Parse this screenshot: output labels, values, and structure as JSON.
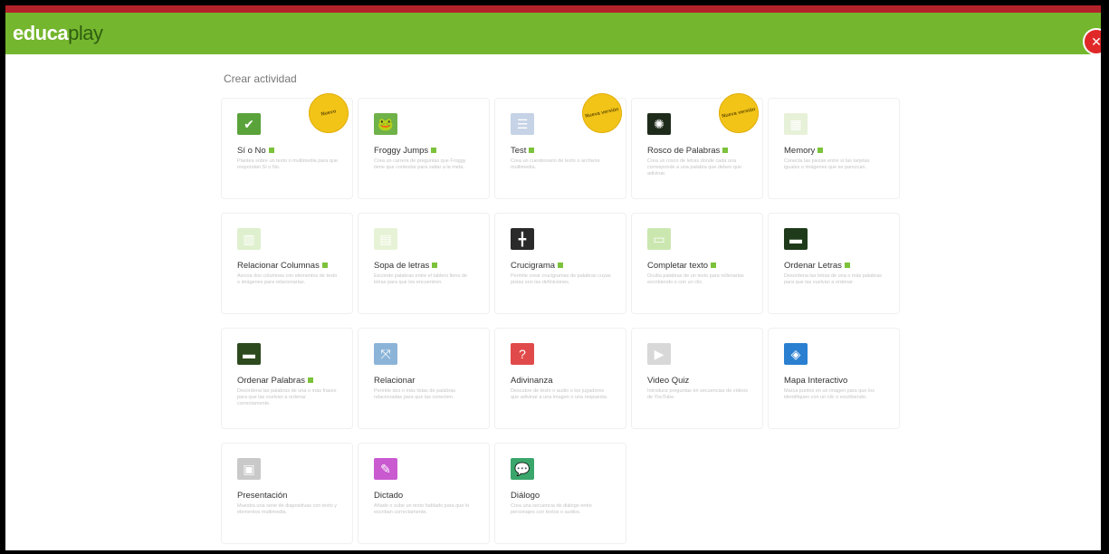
{
  "app": {
    "logo_text": "educa",
    "logo_text_light": "play"
  },
  "colors": {
    "brand_green": "#74b62e",
    "top_strip": "#b3222a",
    "badge": "#f2c418",
    "premium_dot": "#7cc23a"
  },
  "page": {
    "heading": "Crear actividad"
  },
  "activities": [
    {
      "name": "Sí o No",
      "desc": "Plantea sobre un texto o multimedia para que respondan Sí o No.",
      "badge": "Nuevo",
      "icon": "check-cross-icon",
      "premium": true
    },
    {
      "name": "Froggy Jumps",
      "desc": "Crea un carrera de preguntas que Froggy tiene que contestar para saltar a la meta.",
      "badge": "",
      "icon": "frog-icon",
      "premium": true
    },
    {
      "name": "Test",
      "desc": "Crea un cuestionario de texto o archivos multimedia.",
      "badge": "Nueva versión",
      "icon": "test-list-icon",
      "premium": true
    },
    {
      "name": "Rosco de Palabras",
      "desc": "Crea un rosco de letras donde cada una corresponde a una palabra que deben que adivinar.",
      "badge": "Nueva versión",
      "icon": "letter-wheel-icon",
      "premium": true
    },
    {
      "name": "Memory",
      "desc": "Conecta las piezas entre sí las tarjetas iguales o imágenes que se parezcan.",
      "badge": "",
      "icon": "memory-cards-icon",
      "premium": true
    },
    {
      "name": "Relacionar Columnas",
      "desc": "Asocia dos columnas con elementos de texto o imágenes para relacionarlas.",
      "badge": "",
      "icon": "columns-icon",
      "premium": true
    },
    {
      "name": "Sopa de letras",
      "desc": "Esconde palabras entre el tablero lleno de letras para que los encuentren.",
      "badge": "",
      "icon": "word-search-icon",
      "premium": true
    },
    {
      "name": "Crucigrama",
      "desc": "Permite crear crucigramas de palabras cuyas pistas son las definiciones.",
      "badge": "",
      "icon": "crossword-icon",
      "premium": true
    },
    {
      "name": "Completar texto",
      "desc": "Oculta palabras de un texto para rellenarlas escribiendo o con un clic.",
      "badge": "",
      "icon": "fill-text-icon",
      "premium": true
    },
    {
      "name": "Ordenar Letras",
      "desc": "Desordena las letras de una o más palabras para que las vuelvan a ordenar.",
      "badge": "",
      "icon": "letters-icon",
      "premium": true
    },
    {
      "name": "Ordenar Palabras",
      "desc": "Desordena las palabras de una o más frases para que las vuelvan a ordenar correctamente.",
      "badge": "",
      "icon": "words-icon",
      "premium": true
    },
    {
      "name": "Relacionar",
      "desc": "Permite dos o más listas de palabras relacionadas para que las conecten.",
      "badge": "",
      "icon": "relate-icon",
      "premium": false
    },
    {
      "name": "Adivinanza",
      "desc": "Descubre de texto o audio o los jugadores que adivinar a una imagen o una respuesta.",
      "badge": "",
      "icon": "riddle-icon",
      "premium": false
    },
    {
      "name": "Video Quiz",
      "desc": "Introduce preguntas en secuencias de vídeos de YouTube.",
      "badge": "",
      "icon": "video-quiz-icon",
      "premium": false
    },
    {
      "name": "Mapa Interactivo",
      "desc": "Marca puntos en un imagen para que los identifiquen con un clic o escribiendo.",
      "badge": "",
      "icon": "map-icon",
      "premium": false
    },
    {
      "name": "Presentación",
      "desc": "Muestra una serie de diapositivas con texto y elementos multimedia.",
      "badge": "",
      "icon": "presentation-icon",
      "premium": false
    },
    {
      "name": "Dictado",
      "desc": "Añade o sube un texto hablado para que lo escriban correctamente.",
      "badge": "",
      "icon": "dictation-icon",
      "premium": false
    },
    {
      "name": "Diálogo",
      "desc": "Crea una secuencia de diálogo entre personajes con textos o audios.",
      "badge": "",
      "icon": "dialogue-icon",
      "premium": false
    }
  ]
}
